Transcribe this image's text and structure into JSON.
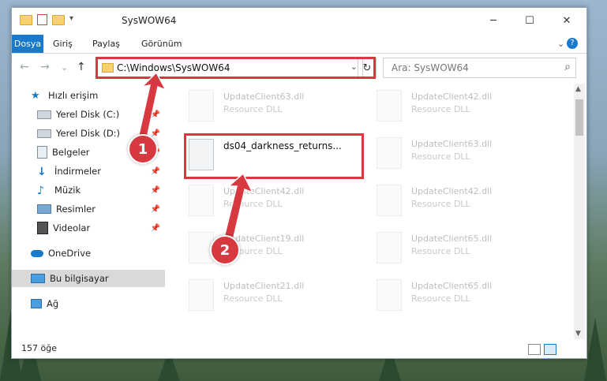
{
  "window": {
    "title": "SysWOW64",
    "minimize": "─",
    "maximize": "☐",
    "close": "✕"
  },
  "ribbon": {
    "tabs": [
      "Dosya",
      "Giriş",
      "Paylaş",
      "Görünüm"
    ],
    "collapse_icon": "⌄",
    "help_icon": "?"
  },
  "navigation": {
    "back": "←",
    "forward": "→",
    "recent": "⌄",
    "up": "↑",
    "address": "C:\\Windows\\SysWOW64",
    "address_dropdown": "⌄",
    "refresh": "↻",
    "search_placeholder": "Ara: SysWOW64",
    "search_icon": "⌕"
  },
  "sidebar": {
    "items": [
      {
        "label": "Hızlı erişim",
        "icon": "star-icon"
      },
      {
        "label": "Yerel Disk (C:)",
        "icon": "drive-icon",
        "pinned": true
      },
      {
        "label": "Yerel Disk (D:)",
        "icon": "drive-icon",
        "pinned": true
      },
      {
        "label": "Belgeler",
        "icon": "document-icon",
        "pinned": true
      },
      {
        "label": "İndirmeler",
        "icon": "download-icon",
        "pinned": true
      },
      {
        "label": "Müzik",
        "icon": "music-icon",
        "pinned": true
      },
      {
        "label": "Resimler",
        "icon": "pictures-icon",
        "pinned": true
      },
      {
        "label": "Videolar",
        "icon": "video-icon",
        "pinned": true
      },
      {
        "label": "OneDrive",
        "icon": "cloud-icon"
      },
      {
        "label": "Bu bilgisayar",
        "icon": "computer-icon",
        "selected": true
      },
      {
        "label": "Ağ",
        "icon": "network-icon"
      }
    ],
    "pin_glyph": "📌"
  },
  "files": [
    {
      "name": "UpdateClient63.dll",
      "type": "Resource DLL"
    },
    {
      "name": "UpdateClient42.dll",
      "type": "Resource DLL"
    },
    {
      "name": "ds04_darkness_returns...",
      "type": ""
    },
    {
      "name": "UpdateClient63.dll",
      "type": "Resource DLL"
    },
    {
      "name": "UpdateClient42.dll",
      "type": "Resource DLL"
    },
    {
      "name": "UpdateClient42.dll",
      "type": "Resource DLL"
    },
    {
      "name": "UpdateClient19.dll",
      "type": "Resource DLL"
    },
    {
      "name": "UpdateClient65.dll",
      "type": "Resource DLL"
    },
    {
      "name": "UpdateClient21.dll",
      "type": "Resource DLL"
    },
    {
      "name": "UpdateClient65.dll",
      "type": "Resource DLL"
    }
  ],
  "status": {
    "count": "157 öğe"
  },
  "annotations": {
    "step1": "1",
    "step2": "2"
  },
  "colors": {
    "accent": "#1979ca",
    "highlight": "#d8383f"
  }
}
